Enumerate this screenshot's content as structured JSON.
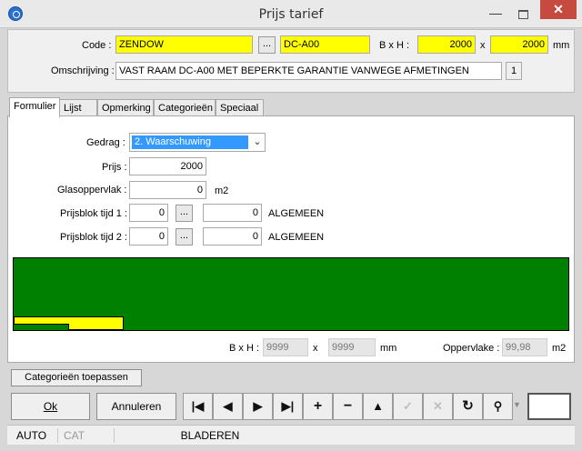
{
  "window": {
    "title": "Prijs tarief",
    "minimize": "—",
    "close": "✕"
  },
  "header": {
    "code_label": "Code :",
    "code_value": "ZENDOW",
    "browse": "...",
    "code2_value": "DC-A00",
    "bxh_label": "B x H :",
    "width_value": "2000",
    "x_sep": "x",
    "height_value": "2000",
    "unit_mm": "mm",
    "desc_label": "Omschrijving :",
    "desc_value": "VAST RAAM DC-A00 MET BEPERKTE GARANTIE VANWEGE AFMETINGEN",
    "desc_count": "1"
  },
  "tabs": [
    {
      "label": "Formulier",
      "active": true
    },
    {
      "label": "Lijst",
      "active": false
    },
    {
      "label": "Opmerking",
      "active": false
    },
    {
      "label": "Categorieën",
      "active": false
    },
    {
      "label": "Speciaal",
      "active": false
    }
  ],
  "form": {
    "gedrag_label": "Gedrag :",
    "gedrag_value": "2. Waarschuwing",
    "prijs_label": "Prijs :",
    "prijs_value": "2000",
    "glas_label": "Glasoppervlak :",
    "glas_value": "0",
    "glas_unit": "m2",
    "pb1_label": "Prijsblok tijd 1 :",
    "pb1_value": "0",
    "pb1_browse": "...",
    "pb1_value2": "0",
    "pb1_text": "ALGEMEEN",
    "pb2_label": "Prijsblok tijd 2 :",
    "pb2_value": "0",
    "pb2_browse": "...",
    "pb2_value2": "0",
    "pb2_text": "ALGEMEEN"
  },
  "footer_info": {
    "bxh_label": "B x H :",
    "width": "9999",
    "x_sep": "x",
    "height": "9999",
    "unit_mm": "mm",
    "area_label": "Oppervlake :",
    "area_value": "99,98",
    "area_unit": "m2"
  },
  "buttons": {
    "apply_categories": "Categorieën toepassen",
    "ok": "Ok",
    "cancel": "Annuleren"
  },
  "nav_icons": [
    "first-record-icon",
    "prev-record-icon",
    "next-record-icon",
    "last-record-icon",
    "add-icon",
    "delete-icon",
    "up-icon",
    "confirm-icon",
    "cancel-icon",
    "refresh-icon",
    "search-binoculars-icon"
  ],
  "statusbar": {
    "mode1": "AUTO",
    "mode2": "CAT",
    "state": "BLADEREN"
  },
  "colors": {
    "highlight": "#ffff00",
    "preview_green": "#008000",
    "selection": "#3399ff"
  }
}
